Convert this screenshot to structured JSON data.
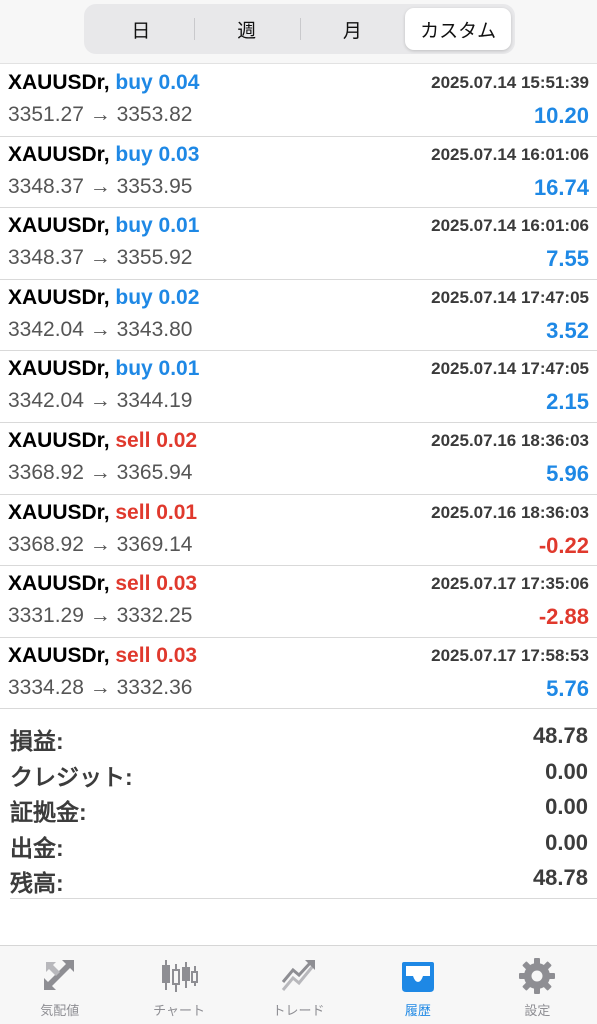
{
  "period_tabs": [
    {
      "label": "日",
      "active": false
    },
    {
      "label": "週",
      "active": false
    },
    {
      "label": "月",
      "active": false
    },
    {
      "label": "カスタム",
      "active": true
    }
  ],
  "trades": [
    {
      "symbol": "XAUUSDr,",
      "side": "buy",
      "lots": "0.04",
      "side_text": "buy 0.04",
      "time": "2025.07.14 15:51:39",
      "prices": "3351.27 → 3353.82",
      "profit": "10.20"
    },
    {
      "symbol": "XAUUSDr,",
      "side": "buy",
      "lots": "0.03",
      "side_text": "buy 0.03",
      "time": "2025.07.14 16:01:06",
      "prices": "3348.37 → 3353.95",
      "profit": "16.74"
    },
    {
      "symbol": "XAUUSDr,",
      "side": "buy",
      "lots": "0.01",
      "side_text": "buy 0.01",
      "time": "2025.07.14 16:01:06",
      "prices": "3348.37 → 3355.92",
      "profit": "7.55"
    },
    {
      "symbol": "XAUUSDr,",
      "side": "buy",
      "lots": "0.02",
      "side_text": "buy 0.02",
      "time": "2025.07.14 17:47:05",
      "prices": "3342.04 → 3343.80",
      "profit": "3.52"
    },
    {
      "symbol": "XAUUSDr,",
      "side": "buy",
      "lots": "0.01",
      "side_text": "buy 0.01",
      "time": "2025.07.14 17:47:05",
      "prices": "3342.04 → 3344.19",
      "profit": "2.15"
    },
    {
      "symbol": "XAUUSDr,",
      "side": "sell",
      "lots": "0.02",
      "side_text": "sell 0.02",
      "time": "2025.07.16 18:36:03",
      "prices": "3368.92 → 3365.94",
      "profit": "5.96"
    },
    {
      "symbol": "XAUUSDr,",
      "side": "sell",
      "lots": "0.01",
      "side_text": "sell 0.01",
      "time": "2025.07.16 18:36:03",
      "prices": "3368.92 → 3369.14",
      "profit": "-0.22"
    },
    {
      "symbol": "XAUUSDr,",
      "side": "sell",
      "lots": "0.03",
      "side_text": "sell 0.03",
      "time": "2025.07.17 17:35:06",
      "prices": "3331.29 → 3332.25",
      "profit": "-2.88"
    },
    {
      "symbol": "XAUUSDr,",
      "side": "sell",
      "lots": "0.03",
      "side_text": "sell 0.03",
      "time": "2025.07.17 17:58:53",
      "prices": "3334.28 → 3332.36",
      "profit": "5.76"
    }
  ],
  "summary": [
    {
      "label": "損益:",
      "value": "48.78"
    },
    {
      "label": "クレジット:",
      "value": "0.00"
    },
    {
      "label": "証拠金:",
      "value": "0.00"
    },
    {
      "label": "出金:",
      "value": "0.00"
    },
    {
      "label": "残高:",
      "value": "48.78"
    }
  ],
  "tabbar": [
    {
      "label": "気配値",
      "icon": "quotes-icon",
      "active": false
    },
    {
      "label": "チャート",
      "icon": "chart-icon",
      "active": false
    },
    {
      "label": "トレード",
      "icon": "trade-icon",
      "active": false
    },
    {
      "label": "履歴",
      "icon": "history-icon",
      "active": true
    },
    {
      "label": "設定",
      "icon": "settings-icon",
      "active": false
    }
  ],
  "colors": {
    "buy": "#1e88e5",
    "sell": "#e0392d",
    "active_tab": "#1e88e5",
    "inactive_tab": "#8e8e93"
  }
}
